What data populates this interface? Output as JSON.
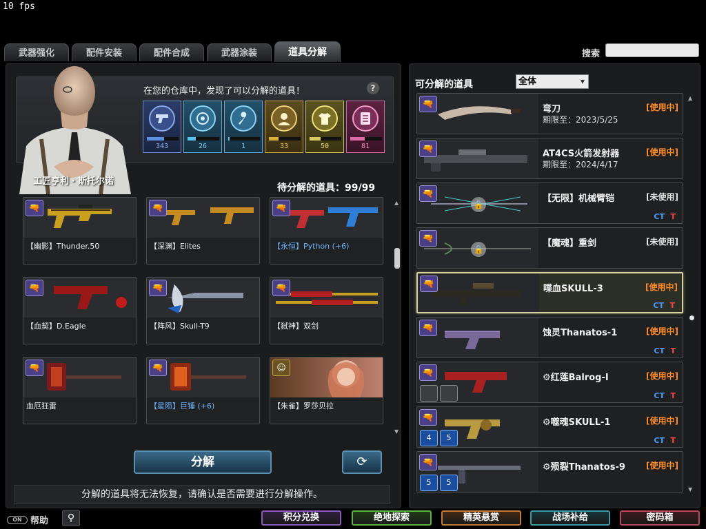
{
  "fps": "10 fps",
  "tabs": [
    {
      "label": "武器强化"
    },
    {
      "label": "配件安装"
    },
    {
      "label": "配件合成"
    },
    {
      "label": "武器涂装"
    },
    {
      "label": "道具分解",
      "active": true
    }
  ],
  "search": {
    "label": "搜索",
    "placeholder": ""
  },
  "npc": {
    "name": "工匠亨利・斯托尔诺",
    "message": "在您的仓库中，发现了可以分解的道具！",
    "help": "?"
  },
  "categories": [
    {
      "icon": "pistol-icon",
      "count": "343",
      "fill": 0.55,
      "color": "#5c8fe0"
    },
    {
      "icon": "target-icon",
      "count": "26",
      "fill": 0.25,
      "color": "#5cc0e8"
    },
    {
      "icon": "wrench-icon",
      "count": "1",
      "fill": 0.05,
      "color": "#5cc0e8"
    },
    {
      "icon": "character-icon",
      "count": "33",
      "fill": 0.3,
      "color": "#d8b040"
    },
    {
      "icon": "shirt-icon",
      "count": "50",
      "fill": 0.35,
      "color": "#d8c860"
    },
    {
      "icon": "document-icon",
      "count": "81",
      "fill": 0.45,
      "color": "#e06aa8"
    }
  ],
  "pending": "待分解的道具：99/99",
  "pending_items": [
    {
      "name": "【幽影】Thunder.50",
      "highlight": false,
      "badge": "weapon"
    },
    {
      "name": "【深渊】Elites",
      "highlight": false,
      "badge": "weapon"
    },
    {
      "name": "【永恒】Python (+6)",
      "highlight": true,
      "badge": "weapon"
    },
    {
      "name": "【血契】D.Eagle",
      "highlight": false,
      "badge": "weapon"
    },
    {
      "name": "【阵风】Skull-T9",
      "highlight": false,
      "badge": "weapon"
    },
    {
      "name": "【弑神】双剑",
      "highlight": false,
      "badge": "weapon"
    },
    {
      "name": "血厄狂雷",
      "highlight": false,
      "badge": "weapon"
    },
    {
      "name": "【星陨】巨锤 (+6)",
      "highlight": true,
      "badge": "weapon"
    },
    {
      "name": "【朱雀】罗莎贝拉",
      "highlight": false,
      "badge": "character"
    }
  ],
  "actions": {
    "decompose": "分解",
    "refresh_icon": "refresh-icon"
  },
  "warning": "分解的道具将无法恢复，请确认是否需要进行分解操作。",
  "right": {
    "title": "可分解的道具",
    "filter": "全体",
    "items": [
      {
        "name": "弯刀",
        "date": "期限至：2023/5/25",
        "status": "[使用中]",
        "status_type": "using",
        "ct": "",
        "t": "",
        "locked": false,
        "selected": false,
        "slots": []
      },
      {
        "name": "AT4CS火箭发射器",
        "date": "期限至：2024/4/17",
        "status": "[使用中]",
        "status_type": "using",
        "ct": "",
        "t": "",
        "locked": false,
        "selected": false,
        "slots": []
      },
      {
        "name": "【无限】机械臂铠",
        "date": "",
        "status": "[未使用]",
        "status_type": "unused",
        "ct": "CT",
        "t": "T",
        "locked": true,
        "selected": false,
        "slots": []
      },
      {
        "name": "【魔魂】重剑",
        "date": "",
        "status": "[未使用]",
        "status_type": "unused",
        "ct": "",
        "t": "",
        "locked": true,
        "selected": false,
        "slots": []
      },
      {
        "name": "喋血SKULL-3",
        "date": "",
        "status": "[使用中]",
        "status_type": "using",
        "ct": "CT",
        "t": "T",
        "locked": false,
        "selected": true,
        "slots": []
      },
      {
        "name": "蚀灵Thanatos-1",
        "date": "",
        "status": "[使用中]",
        "status_type": "using",
        "ct": "CT",
        "t": "T",
        "locked": false,
        "selected": false,
        "slots": []
      },
      {
        "name": "⚙红莲Balrog-Ⅰ",
        "date": "",
        "status": "[使用中]",
        "status_type": "using",
        "ct": "CT",
        "t": "T",
        "locked": false,
        "selected": false,
        "slots": [
          "empty",
          "empty"
        ]
      },
      {
        "name": "⚙噬魂SKULL-1",
        "date": "",
        "status": "[使用中]",
        "status_type": "using",
        "ct": "CT",
        "t": "T",
        "locked": false,
        "selected": false,
        "slots": [
          "4",
          "5"
        ]
      },
      {
        "name": "⚙殒裂Thanatos-9",
        "date": "",
        "status": "[使用中]",
        "status_type": "using",
        "ct": "",
        "t": "",
        "locked": false,
        "selected": false,
        "slots": [
          "5",
          "5"
        ]
      }
    ]
  },
  "bottom": {
    "help": "帮助",
    "toggle": "ON",
    "buttons": [
      {
        "label": "积分兑换",
        "color": "#8a5ab8"
      },
      {
        "label": "绝地探索",
        "color": "#5fb046"
      },
      {
        "label": "精英悬赏",
        "color": "#c07a3a"
      },
      {
        "label": "战场补给",
        "color": "#3f9aa8"
      },
      {
        "label": "密码箱",
        "color": "#b84a5a"
      }
    ]
  }
}
